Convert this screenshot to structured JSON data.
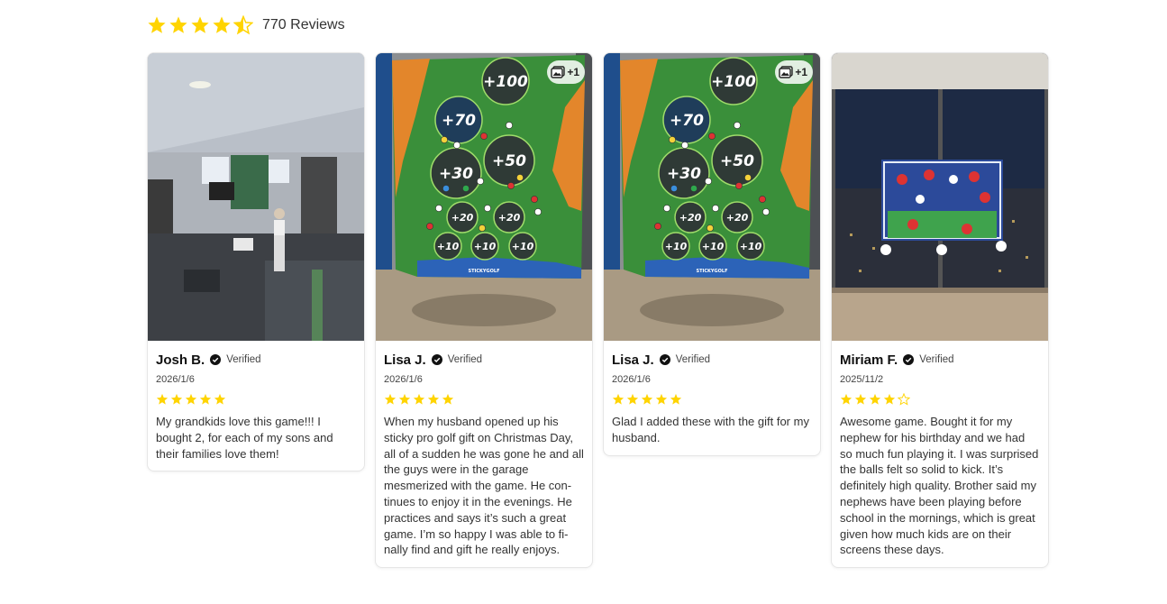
{
  "summary": {
    "rating": 4.5,
    "stars_full": 4,
    "stars_half": 1,
    "review_count_label": "770 Reviews",
    "star_color": "#ffd400"
  },
  "reviews": [
    {
      "author": "Josh B.",
      "verified_label": "Verified",
      "date": "2026/1/6",
      "rating": 5,
      "text": "My grandkids love this game!!! I bought 2, for each of my sons and their families love them!",
      "photo": "basement-golf-photo",
      "extra_photos": ""
    },
    {
      "author": "Lisa J.",
      "verified_label": "Verified",
      "date": "2026/1/6",
      "rating": 5,
      "text": "When my husband opened up  his sticky pro  golf gift on Christmas Day,  all of a sudden he was gone he and all the guys were in the garage mesmerized with the game. He con­tinues to enjoy it in the evenings. He practices and says it’s such a great game. I’m so happy I was able to fi­nally find and gift he really enjoys.",
      "photo": "golf-target-mat-photo",
      "extra_photos": "+1"
    },
    {
      "author": "Lisa J.",
      "verified_label": "Verified",
      "date": "2026/1/6",
      "rating": 5,
      "text": "Glad I added these with the gift for my husband.",
      "photo": "golf-target-mat-photo",
      "extra_photos": "+1"
    },
    {
      "author": "Miriam F.",
      "verified_label": "Verified",
      "date": "2025/11/2",
      "rating": 4,
      "text": "Awesome game. Bought it for my nephew for his birthday and we had so much fun playing it. I was surpri­sed the balls felt so solid to kick. It’s definitely high quality. Brother said my nephews have been playing be­fore school in the mornings, which is great given how much kids are on their screens these days.",
      "photo": "soccer-target-window-photo",
      "extra_photos": ""
    }
  ],
  "target_labels": [
    "+100",
    "+70",
    "+50",
    "+30",
    "+20",
    "+20",
    "+10",
    "+10",
    "+10"
  ],
  "brand_mark": "STICKYGOLF"
}
